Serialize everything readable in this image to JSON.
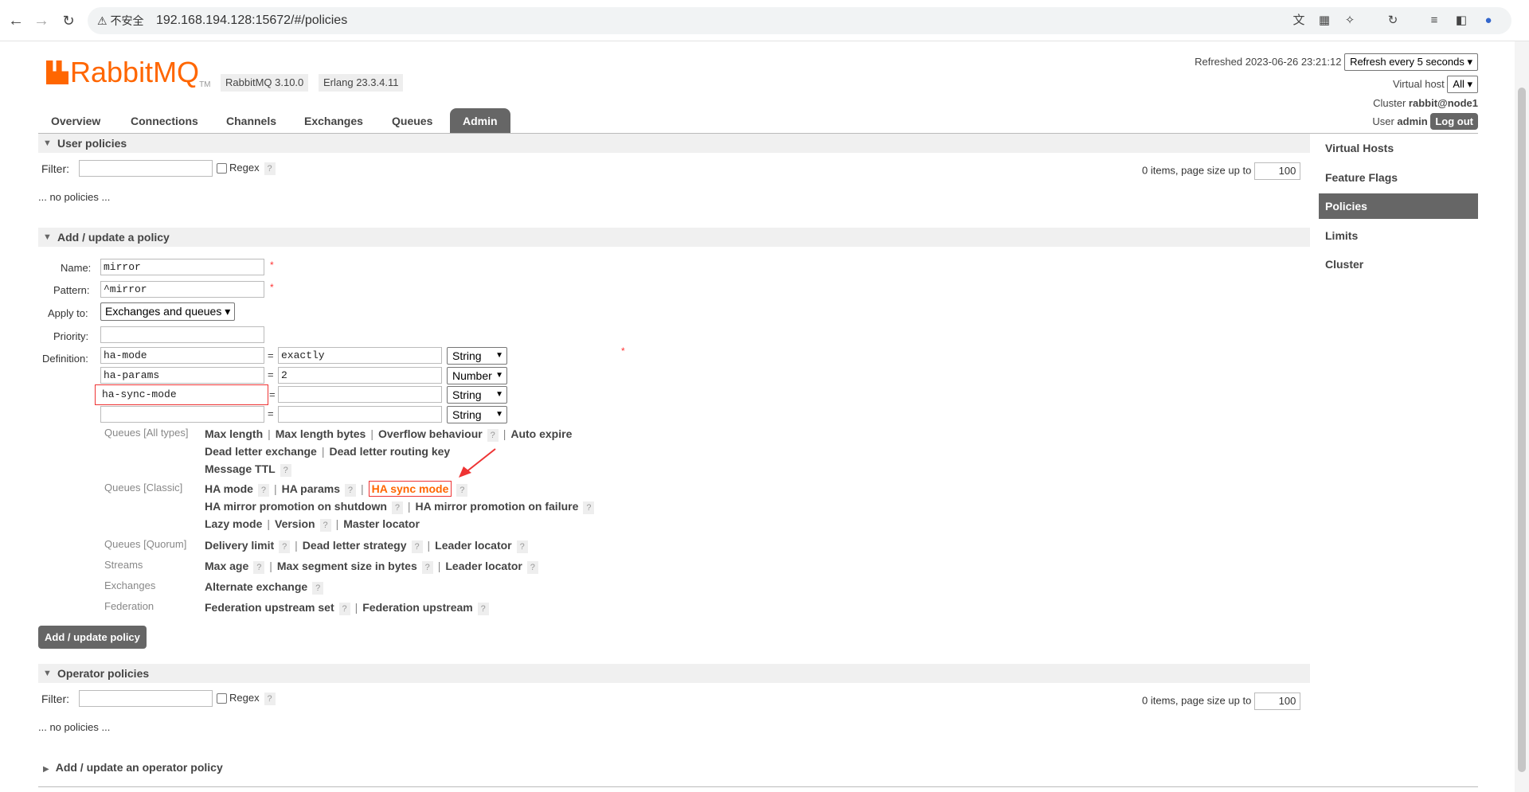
{
  "browser": {
    "warning": "不安全",
    "url": "192.168.194.128:15672/#/policies"
  },
  "header": {
    "logo_main": "RabbitMQ",
    "logo_tm": "TM",
    "version": "RabbitMQ 3.10.0",
    "erlang": "Erlang 23.3.4.11",
    "refreshed_label": "Refreshed 2023-06-26 23:21:12",
    "refresh_select": "Refresh every 5 seconds",
    "vhost_label": "Virtual host",
    "vhost_select": "All",
    "cluster_label": "Cluster",
    "cluster_value": "rabbit@node1",
    "user_label": "User",
    "user_value": "admin",
    "logout": "Log out"
  },
  "tabs": [
    "Overview",
    "Connections",
    "Channels",
    "Exchanges",
    "Queues",
    "Admin"
  ],
  "sidebar": [
    "Virtual Hosts",
    "Feature Flags",
    "Policies",
    "Limits",
    "Cluster"
  ],
  "user_policies": {
    "title": "User policies",
    "filter_label": "Filter:",
    "regex_label": "Regex",
    "q": "?",
    "items_text": "0 items, page size up to",
    "page_size": "100",
    "empty": "... no policies ..."
  },
  "add_policy": {
    "title": "Add / update a policy",
    "name_label": "Name:",
    "name_value": "mirror",
    "pattern_label": "Pattern:",
    "pattern_value": "^mirror",
    "apply_label": "Apply to:",
    "apply_value": "Exchanges and queues",
    "priority_label": "Priority:",
    "definition_label": "Definition:",
    "req": "*",
    "eq": "=",
    "definitions": [
      {
        "key": "ha-mode",
        "value": "exactly",
        "type": "String"
      },
      {
        "key": "ha-params",
        "value": "2",
        "type": "Number"
      },
      {
        "key": "ha-sync-mode",
        "value": "",
        "type": "String"
      },
      {
        "key": "",
        "value": "",
        "type": "String"
      }
    ],
    "groups": {
      "all": "Queues [All types]",
      "classic": "Queues [Classic]",
      "quorum": "Queues [Quorum]",
      "streams": "Streams",
      "exchanges": "Exchanges",
      "federation": "Federation"
    },
    "keys": {
      "max_length": "Max length",
      "max_length_bytes": "Max length bytes",
      "overflow": "Overflow behaviour",
      "auto_expire": "Auto expire",
      "dlx": "Dead letter exchange",
      "dlrk": "Dead letter routing key",
      "ttl": "Message TTL",
      "ha_mode": "HA mode",
      "ha_params": "HA params",
      "ha_sync": "HA sync mode",
      "ha_shutdown": "HA mirror promotion on shutdown",
      "ha_failure": "HA mirror promotion on failure",
      "lazy": "Lazy mode",
      "version": "Version",
      "master": "Master locator",
      "delivery": "Delivery limit",
      "dls": "Dead letter strategy",
      "leader": "Leader locator",
      "max_age": "Max age",
      "max_seg": "Max segment size in bytes",
      "alt_ex": "Alternate exchange",
      "fed_set": "Federation upstream set",
      "fed_up": "Federation upstream"
    },
    "sep": "|",
    "submit": "Add / update policy"
  },
  "operator_policies": {
    "title": "Operator policies",
    "filter_label": "Filter:",
    "regex_label": "Regex",
    "items_text": "0 items, page size up to",
    "page_size": "100",
    "empty": "... no policies ...",
    "add_title": "Add / update an operator policy"
  }
}
